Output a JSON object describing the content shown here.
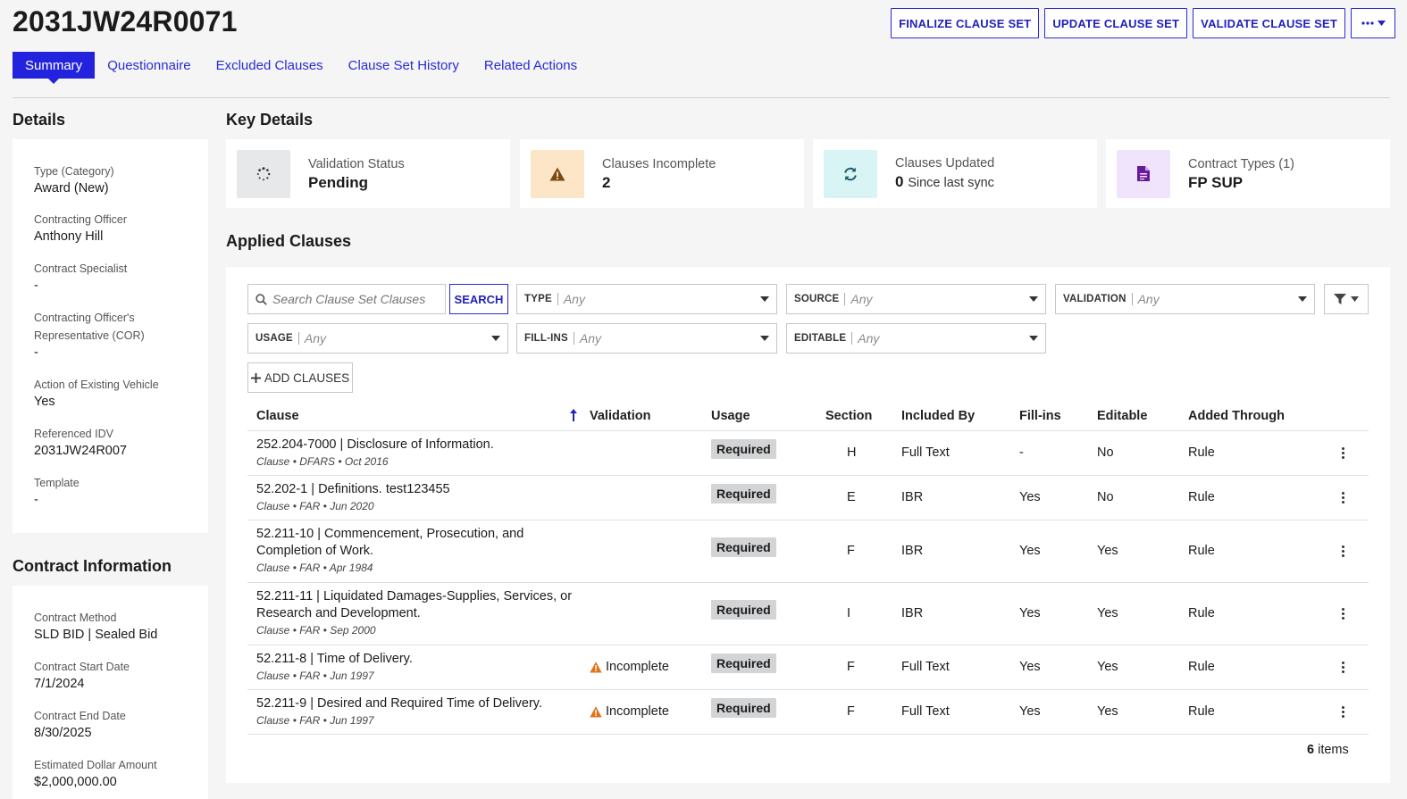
{
  "header": {
    "title": "2031JW24R0071",
    "actions": [
      "FINALIZE CLAUSE SET",
      "UPDATE CLAUSE SET",
      "VALIDATE CLAUSE SET"
    ]
  },
  "tabs": [
    {
      "label": "Summary",
      "active": true
    },
    {
      "label": "Questionnaire"
    },
    {
      "label": "Excluded Clauses"
    },
    {
      "label": "Clause Set History"
    },
    {
      "label": "Related Actions"
    }
  ],
  "details": {
    "heading": "Details",
    "fields": [
      {
        "label": "Type (Category)",
        "value": "Award (New)"
      },
      {
        "label": "Contracting Officer",
        "value": "Anthony Hill"
      },
      {
        "label": "Contract Specialist",
        "value": "-"
      },
      {
        "label": "Contracting Officer's Representative (COR)",
        "value": "-"
      },
      {
        "label": "Action of Existing Vehicle",
        "value": "Yes"
      },
      {
        "label": "Referenced IDV",
        "value": "2031JW24R007"
      },
      {
        "label": "Template",
        "value": "-"
      }
    ]
  },
  "contract_info": {
    "heading": "Contract Information",
    "fields": [
      {
        "label": "Contract Method",
        "value": "SLD BID | Sealed Bid"
      },
      {
        "label": "Contract Start Date",
        "value": "7/1/2024"
      },
      {
        "label": "Contract End Date",
        "value": "8/30/2025"
      },
      {
        "label": "Estimated Dollar Amount",
        "value": "$2,000,000.00"
      }
    ]
  },
  "key_details": {
    "heading": "Key Details",
    "cards": [
      {
        "label": "Validation Status",
        "value": "Pending",
        "sub": "",
        "icon": "spinner-icon",
        "bg": "#e7e8ea"
      },
      {
        "label": "Clauses Incomplete",
        "value": "2",
        "sub": "",
        "icon": "warning-icon",
        "bg": "#fde5c8"
      },
      {
        "label": "Clauses Updated",
        "value": "0",
        "sub": "Since last sync",
        "icon": "refresh-icon",
        "bg": "#d8f4f5"
      },
      {
        "label": "Contract Types (1)",
        "value": "FP SUP",
        "sub": "",
        "icon": "document-icon",
        "bg": "#efe4fb"
      }
    ]
  },
  "applied": {
    "heading": "Applied Clauses",
    "search_placeholder": "Search Clause Set Clauses",
    "search_button": "SEARCH",
    "filters": [
      {
        "label": "TYPE",
        "value": "Any"
      },
      {
        "label": "SOURCE",
        "value": "Any"
      },
      {
        "label": "VALIDATION",
        "value": "Any"
      },
      {
        "label": "USAGE",
        "value": "Any"
      },
      {
        "label": "FILL-INS",
        "value": "Any"
      },
      {
        "label": "EDITABLE",
        "value": "Any"
      }
    ],
    "add_button": "ADD CLAUSES",
    "columns": [
      "Clause",
      "Validation",
      "Usage",
      "Section",
      "Included By",
      "Fill-ins",
      "Editable",
      "Added Through"
    ],
    "rows": [
      {
        "title1": "252.204-7000 | Disclosure of Information.",
        "title2": "",
        "meta": "Clause • DFARS • Oct 2016",
        "validation": "",
        "usage": "Required",
        "section": "H",
        "included_by": "Full Text",
        "fill_ins": "-",
        "editable": "No",
        "added_through": "Rule"
      },
      {
        "title1": "52.202-1 | Definitions. test123455",
        "title2": "",
        "meta": "Clause • FAR • Jun 2020",
        "validation": "",
        "usage": "Required",
        "section": "E",
        "included_by": "IBR",
        "fill_ins": "Yes",
        "editable": "No",
        "added_through": "Rule"
      },
      {
        "title1": "52.211-10 | Commencement, Prosecution, and",
        "title2": "Completion of Work.",
        "meta": "Clause • FAR • Apr 1984",
        "validation": "",
        "usage": "Required",
        "section": "F",
        "included_by": "IBR",
        "fill_ins": "Yes",
        "editable": "Yes",
        "added_through": "Rule"
      },
      {
        "title1": "52.211-11 | Liquidated Damages-Supplies, Services, or",
        "title2": "Research and Development.",
        "meta": "Clause • FAR • Sep 2000",
        "validation": "",
        "usage": "Required",
        "section": "I",
        "included_by": "IBR",
        "fill_ins": "Yes",
        "editable": "Yes",
        "added_through": "Rule"
      },
      {
        "title1": "52.211-8 | Time of Delivery.",
        "title2": "",
        "meta": "Clause • FAR • Jun 1997",
        "validation": "Incomplete",
        "usage": "Required",
        "section": "F",
        "included_by": "Full Text",
        "fill_ins": "Yes",
        "editable": "Yes",
        "added_through": "Rule"
      },
      {
        "title1": "52.211-9 | Desired and Required Time of Delivery.",
        "title2": "",
        "meta": "Clause • FAR • Jun 1997",
        "validation": "Incomplete",
        "usage": "Required",
        "section": "F",
        "included_by": "Full Text",
        "fill_ins": "Yes",
        "editable": "Yes",
        "added_through": "Rule"
      }
    ],
    "count_number": "6",
    "count_label": "items"
  },
  "colors": {
    "accent": "#2323dd",
    "warning": "#e0741a"
  }
}
